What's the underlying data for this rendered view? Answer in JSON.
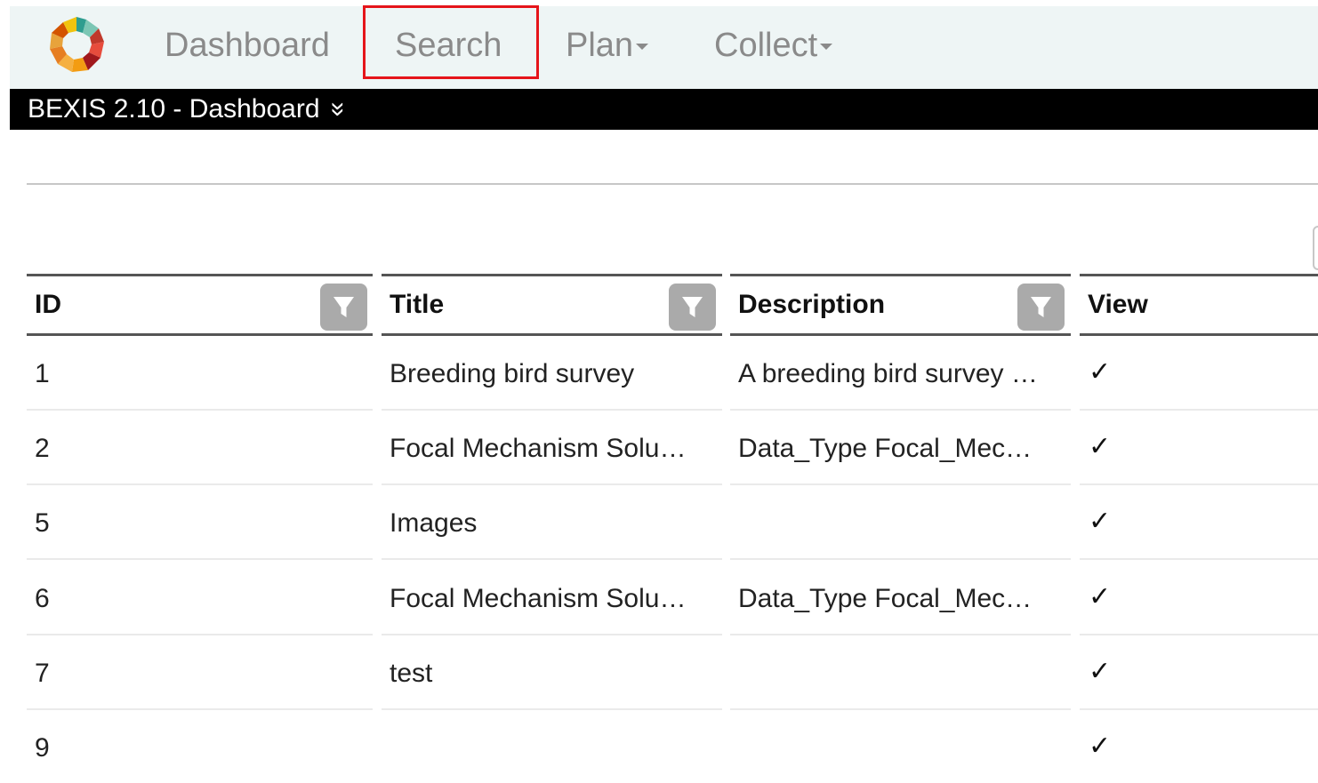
{
  "nav": {
    "items": [
      {
        "label": "Dashboard",
        "has_caret": false
      },
      {
        "label": "Search",
        "has_caret": false,
        "highlighted": true
      },
      {
        "label": "Plan",
        "has_caret": true
      },
      {
        "label": "Collect",
        "has_caret": true
      }
    ]
  },
  "title_bar": {
    "text": "BEXIS 2.10 - Dashboard",
    "icon": "double-chevron-down-icon",
    "glyph": "»"
  },
  "table": {
    "columns": [
      {
        "label": "ID",
        "filterable": true
      },
      {
        "label": "Title",
        "filterable": true
      },
      {
        "label": "Description",
        "filterable": true
      },
      {
        "label": "View",
        "filterable": false
      }
    ],
    "rows": [
      {
        "id": "1",
        "title": "Breeding bird survey",
        "description": "A breeding bird survey …",
        "view": "✓"
      },
      {
        "id": "2",
        "title": "Focal Mechanism Solu…",
        "description": "Data_Type Focal_Mec…",
        "view": "✓"
      },
      {
        "id": "5",
        "title": "Images",
        "description": "",
        "view": "✓"
      },
      {
        "id": "6",
        "title": "Focal Mechanism Solu…",
        "description": "Data_Type Focal_Mec…",
        "view": "✓"
      },
      {
        "id": "7",
        "title": "test",
        "description": "",
        "view": "✓"
      },
      {
        "id": "9",
        "title": "",
        "description": "",
        "view": "✓"
      }
    ]
  },
  "colors": {
    "nav_bg": "#eef5f5",
    "nav_text": "#8a8a8a",
    "highlight_border": "#e5141a",
    "title_bar_bg": "#000000",
    "filter_button_bg": "#aaaaaa"
  }
}
